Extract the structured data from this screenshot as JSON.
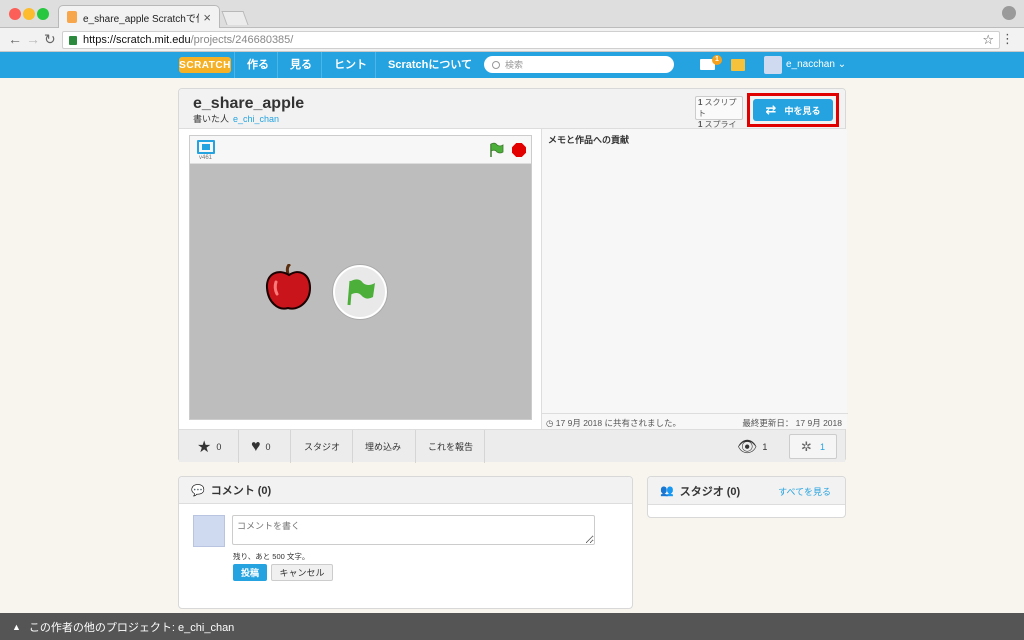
{
  "browser": {
    "tab_title": "e_share_apple Scratchで作成",
    "tab_close": "×",
    "url_host": "https://scratch.mit.edu",
    "url_path": "/projects/246680385/"
  },
  "nav": {
    "logo": "SCRATCH",
    "items": [
      "作る",
      "見る",
      "ヒント",
      "Scratchについて"
    ],
    "search_placeholder": "検索",
    "message_count": "1",
    "username": "e_nacchan"
  },
  "project": {
    "title": "e_share_apple",
    "author_prefix": "書いた人",
    "author": "e_chi_chan",
    "scripts_count": "1",
    "scripts_label": "スクリプト",
    "sprites_count": "1",
    "sprites_label": "スプライト",
    "see_inside": "中を見る",
    "version": "v461",
    "notes_heading": "メモと作品への貢献",
    "shared_text": "17 9月 2018 に共有されました。",
    "updated_text": "最終更新日： 17 9月 2018",
    "love_count": "0",
    "favorite_count": "0",
    "studio_label": "スタジオ",
    "embed_label": "埋め込み",
    "report_label": "これを報告",
    "views": "1",
    "remixes": "1"
  },
  "comments": {
    "heading": "コメント (0)",
    "placeholder": "コメントを書く",
    "remaining": "残り、あと 500 文字。",
    "post": "投稿",
    "cancel": "キャンセル"
  },
  "studios": {
    "heading": "スタジオ (0)",
    "see_all": "すべてを見る"
  },
  "footer": {
    "text": "この作者の他のプロジェクト: e_chi_chan"
  },
  "colors": {
    "accent": "#25a3e0",
    "highlight": "#e00000",
    "stop": "#e30000",
    "flag": "#4caf3a"
  }
}
